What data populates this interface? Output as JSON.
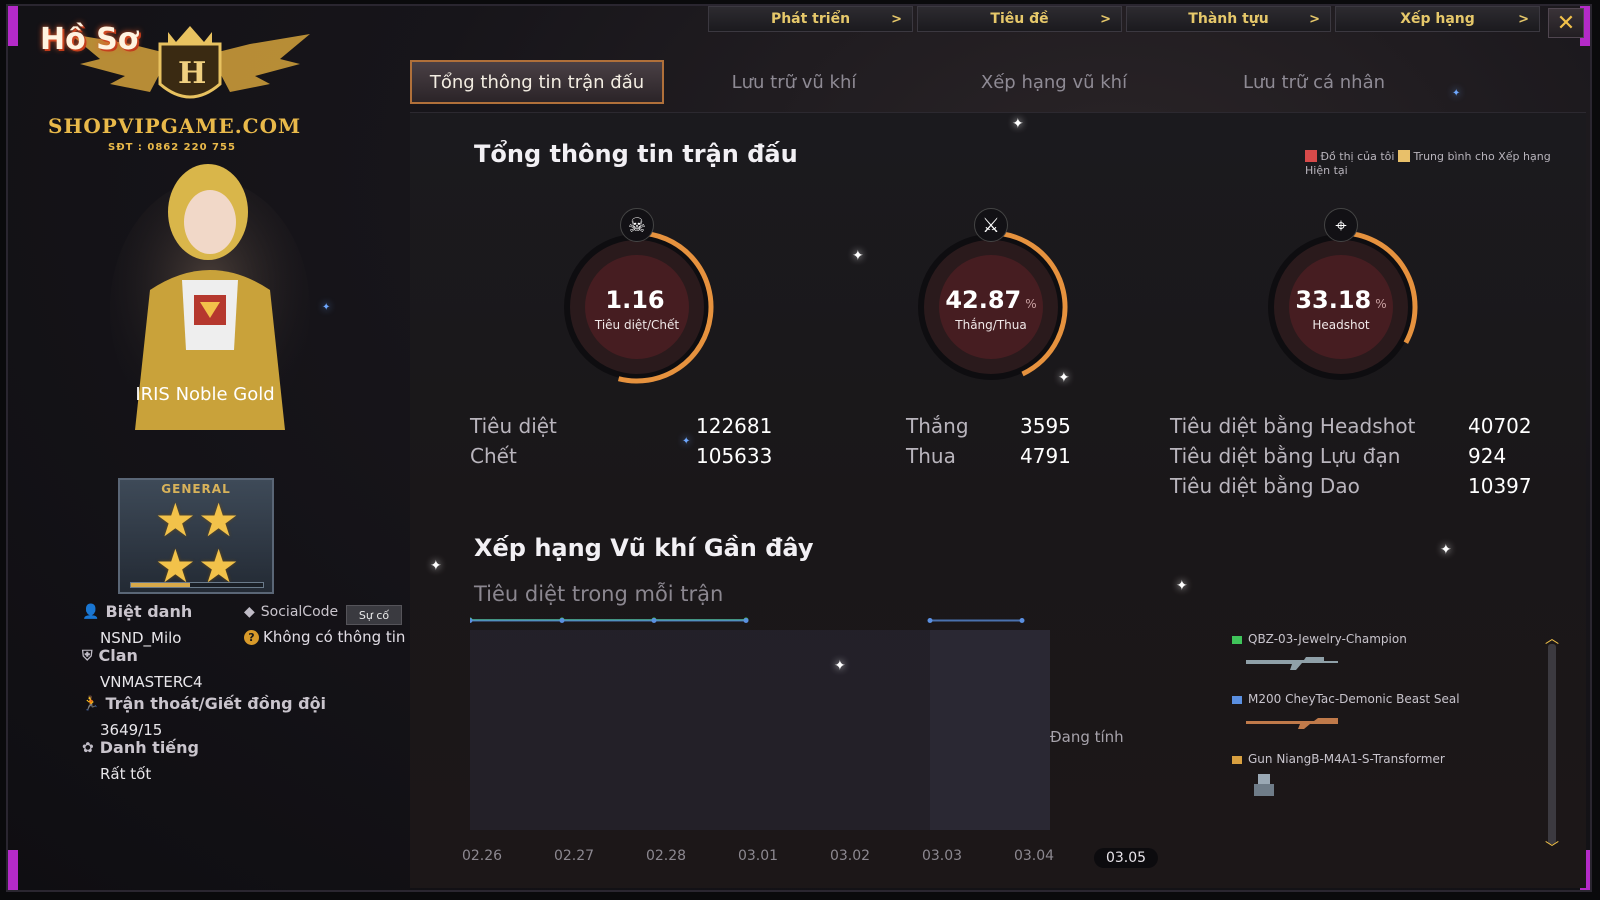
{
  "logo": {
    "title": "Hồ Sơ",
    "monogram": "H",
    "site": "SHOPVIPGAME.COM",
    "phone": "SĐT : 0862 220 755"
  },
  "topnav": [
    {
      "label": "Phát triển",
      "chev": ">"
    },
    {
      "label": "Tiêu đề",
      "chev": ">"
    },
    {
      "label": "Thành tựu",
      "chev": ">"
    },
    {
      "label": "Xếp hạng",
      "chev": ">"
    }
  ],
  "close_label": "✕",
  "tabs": [
    {
      "label": "Tổng thông tin trận đấu",
      "active": true
    },
    {
      "label": "Lưu trữ vũ khí",
      "active": false
    },
    {
      "label": "Xếp hạng vũ khí",
      "active": false
    },
    {
      "label": "Lưu trữ cá nhân",
      "active": false
    }
  ],
  "profile": {
    "character_name": "IRIS Noble Gold",
    "rank": {
      "title": "GENERAL",
      "stars": [
        "★",
        "★",
        "★",
        "★"
      ],
      "progress": 0.45
    },
    "nickname_label": "Biệt danh",
    "nickname_value": "NSND_Milo",
    "socialcode_label": "SocialCode",
    "socialcode_value": "Không có thông tin",
    "report_label": "Sự cố",
    "clan_label": "Clan",
    "clan_value": "VNMASTERC4",
    "escape_label": "Trận thoát/Giết đồng đội",
    "escape_value": "3649/15",
    "reputation_label": "Danh tiếng",
    "reputation_value": "Rất tốt"
  },
  "summary": {
    "title": "Tổng thông tin trận đấu",
    "legend": {
      "mine_label": "Đồ thị của tôi",
      "mine_color": "#d84a4a",
      "avg_label": "Trung bình cho Xếp hạng Hiện tại",
      "avg_color": "#e8c06a"
    },
    "gauges": [
      {
        "value": "1.16",
        "unit": "",
        "label": "Tiêu diệt/Chết",
        "icon": "skull-icon",
        "glyph": "☠",
        "fill": 0.54
      },
      {
        "value": "42.87",
        "unit": "%",
        "label": "Thắng/Thua",
        "icon": "crossed-swords-icon",
        "glyph": "⚔",
        "fill": 0.43
      },
      {
        "value": "33.18",
        "unit": "%",
        "label": "Headshot",
        "icon": "crosshair-icon",
        "glyph": "⌖",
        "fill": 0.33
      }
    ],
    "kills_label": "Tiêu diệt",
    "kills_value": "122681",
    "deaths_label": "Chết",
    "deaths_value": "105633",
    "wins_label": "Thắng",
    "wins_value": "3595",
    "losses_label": "Thua",
    "losses_value": "4791",
    "hs_kills_label": "Tiêu diệt bằng Headshot",
    "hs_kills_value": "40702",
    "grenade_kills_label": "Tiêu diệt bằng Lựu đạn",
    "grenade_kills_value": "924",
    "knife_kills_label": "Tiêu diệt bằng Dao",
    "knife_kills_value": "10397"
  },
  "recent": {
    "title": "Xếp hạng Vũ khí Gần đây",
    "subtitle": "Tiêu diệt trong mỗi trận",
    "pending_label": "Đang tính",
    "weapons": [
      {
        "name": "QBZ-03-Jewelry-Champion",
        "color": "#3fc45a"
      },
      {
        "name": "M200 CheyTac-Demonic Beast Seal",
        "color": "#5a8fe0"
      },
      {
        "name": "Gun NiangB-M4A1-S-Transformer",
        "color": "#d8a040"
      }
    ]
  },
  "chart_data": {
    "type": "line",
    "categories": [
      "02.26",
      "02.27",
      "02.28",
      "03.01",
      "03.02",
      "03.03",
      "03.04",
      "03.05"
    ],
    "current_category": "03.05",
    "series": [
      {
        "color": "#3fc45a",
        "values": [
          1,
          1,
          1,
          1,
          null,
          null,
          null,
          null
        ]
      },
      {
        "color": "#5a8fe0",
        "values": [
          1,
          1,
          1,
          1,
          null,
          1,
          1,
          null
        ]
      }
    ],
    "grid": false
  }
}
